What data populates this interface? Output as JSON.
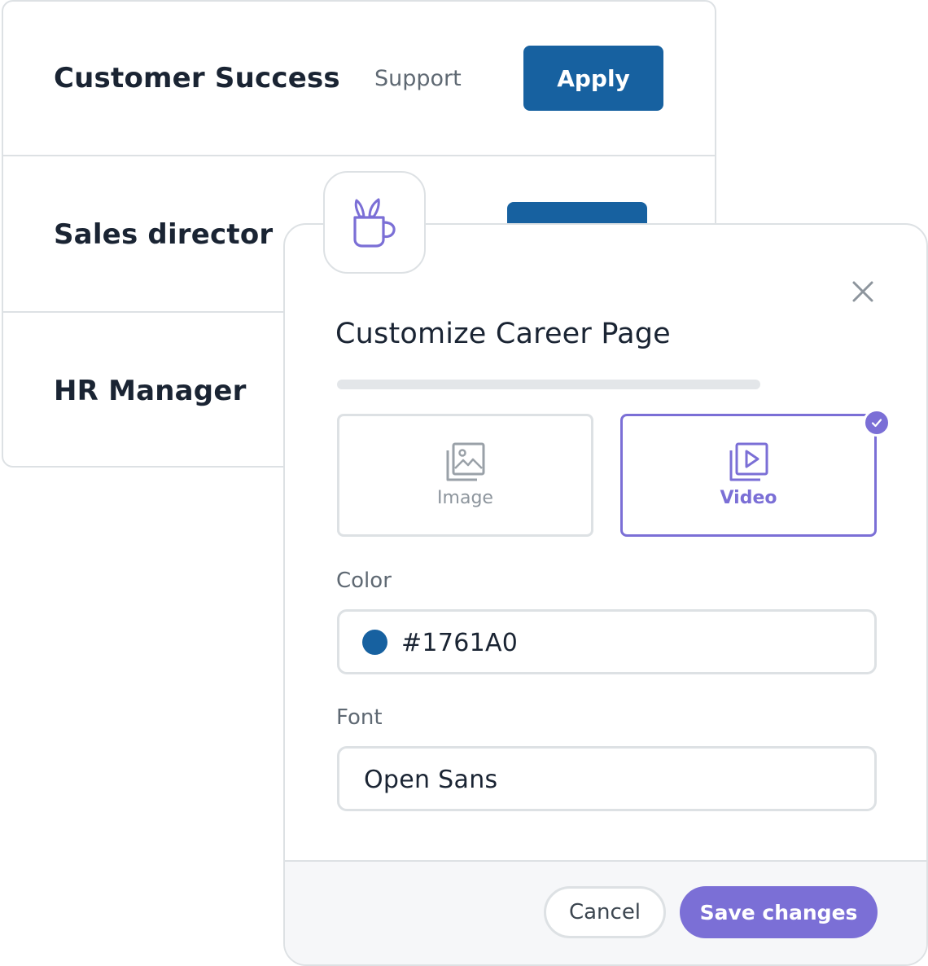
{
  "jobs": [
    {
      "title": "Customer Success",
      "department": "Support",
      "apply_label": "Apply"
    },
    {
      "title": "Sales director"
    },
    {
      "title": "HR Manager"
    }
  ],
  "modal": {
    "title": "Customize Career Page",
    "close_icon": "close-icon",
    "app_icon": "coffee-brush-icon",
    "progress": 0,
    "media_options": [
      {
        "label": "Image",
        "icon": "image-icon",
        "selected": false
      },
      {
        "label": "Video",
        "icon": "video-icon",
        "selected": true
      }
    ],
    "color_label": "Color",
    "color_value": "#1761A0",
    "font_label": "Font",
    "font_value": "Open Sans",
    "cancel_label": "Cancel",
    "save_label": "Save changes"
  },
  "colors": {
    "brand_blue": "#1761A0",
    "accent_purple": "#7B6FD6"
  }
}
